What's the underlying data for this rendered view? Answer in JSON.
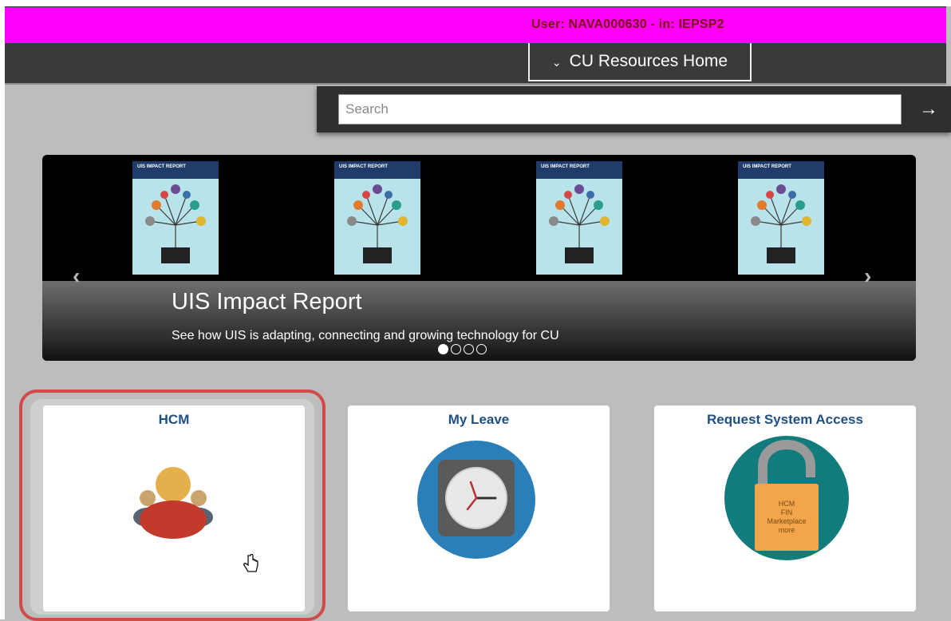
{
  "header": {
    "user_text": "User: NAVA000630 - in: IEPSP2"
  },
  "nav": {
    "home_label": "CU Resources Home",
    "chevron_icon": "chevron-down-icon"
  },
  "search": {
    "placeholder": "Search",
    "value": "",
    "go_icon": "arrow-right-icon"
  },
  "carousel": {
    "title": "UIS Impact Report",
    "subtitle": "See how UIS is adapting, connecting and growing technology for CU",
    "book_header": "UIS IMPACT REPORT",
    "slide_count": 4,
    "active_slide": 1,
    "prev_icon": "chevron-left-icon",
    "next_icon": "chevron-right-icon"
  },
  "tiles": [
    {
      "title": "HCM",
      "icon": "people-group-icon"
    },
    {
      "title": "My Leave",
      "icon": "clock-icon"
    },
    {
      "title": "Request System Access",
      "icon": "padlock-icon",
      "lock_lines": [
        "HCM",
        "FIN",
        "Marketplace",
        "more"
      ]
    }
  ],
  "colors": {
    "user_bar": "#ff00ff",
    "nav_bar": "#3a3a3a",
    "tile_title": "#1f4f86",
    "highlight": "#d14b4b",
    "leave_circle": "#2a7fb8",
    "access_circle": "#127b7e"
  }
}
